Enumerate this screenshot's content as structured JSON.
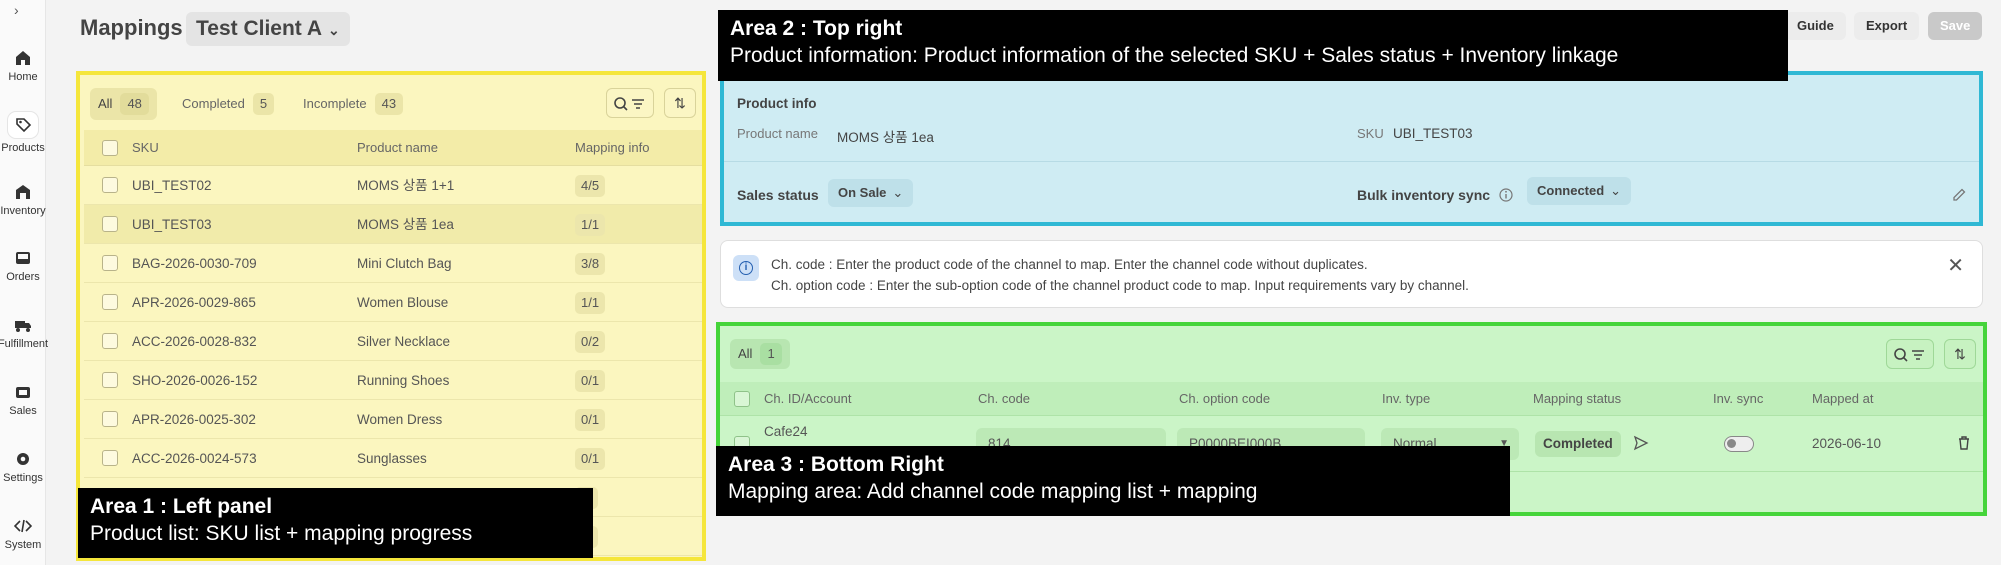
{
  "nav": {
    "toggle_icon": "chevron-right-icon",
    "items": [
      {
        "label": "Home",
        "icon": "home-icon"
      },
      {
        "label": "Products",
        "icon": "tag-icon",
        "active": true
      },
      {
        "label": "Inventory",
        "icon": "warehouse-icon"
      },
      {
        "label": "Orders",
        "icon": "inbox-icon"
      },
      {
        "label": "Fulfillment",
        "icon": "truck-icon"
      },
      {
        "label": "Sales",
        "icon": "store-icon"
      },
      {
        "label": "Settings",
        "icon": "gear-icon"
      },
      {
        "label": "System",
        "icon": "code-icon"
      }
    ]
  },
  "header": {
    "title": "Mappings",
    "client": "Test Client A",
    "guide_label": "Guide",
    "export_label": "Export",
    "save_label": "Save"
  },
  "left_panel": {
    "filters": [
      {
        "label": "All",
        "count": "48",
        "active": true
      },
      {
        "label": "Completed",
        "count": "5"
      },
      {
        "label": "Incomplete",
        "count": "43"
      }
    ],
    "columns": [
      "SKU",
      "Product name",
      "Mapping info"
    ],
    "rows": [
      {
        "sku": "UBI_TEST02",
        "name": "MOMS 상품 1+1",
        "mapping": "4/5"
      },
      {
        "sku": "UBI_TEST03",
        "name": "MOMS 상품 1ea",
        "mapping": "1/1",
        "selected": true
      },
      {
        "sku": "BAG-2026-0030-709",
        "name": "Mini Clutch Bag",
        "mapping": "3/8"
      },
      {
        "sku": "APR-2026-0029-865",
        "name": "Women Blouse",
        "mapping": "1/1"
      },
      {
        "sku": "ACC-2026-0028-832",
        "name": "Silver Necklace",
        "mapping": "0/2"
      },
      {
        "sku": "SHO-2026-0026-152",
        "name": "Running Shoes",
        "mapping": "0/1"
      },
      {
        "sku": "APR-2026-0025-302",
        "name": "Women Dress",
        "mapping": "0/1"
      },
      {
        "sku": "ACC-2026-0024-573",
        "name": "Sunglasses",
        "mapping": "0/1"
      },
      {
        "sku": "",
        "name": "",
        "mapping": "/3"
      },
      {
        "sku": "",
        "name": "",
        "mapping": "/1"
      }
    ]
  },
  "area1": {
    "title": "Area 1 : Left panel",
    "desc": "Product list: SKU list + mapping progress"
  },
  "area2": {
    "title": "Area 2 : Top right",
    "desc": "Product information: Product information of the selected SKU + Sales status + Inventory linkage"
  },
  "area3": {
    "title": "Area 3 : Bottom Right",
    "desc": "Mapping area: Add channel code mapping list + mapping"
  },
  "product_info": {
    "title": "Product info",
    "name_label": "Product name",
    "name_value": "MOMS 상품 1ea",
    "sku_label": "SKU",
    "sku_value": "UBI_TEST03",
    "sales_status_label": "Sales status",
    "sales_status_value": "On Sale",
    "bulk_sync_label": "Bulk inventory sync",
    "bulk_sync_value": "Connected"
  },
  "notice": {
    "line1": "Ch. code : Enter the product code of the channel to map. Enter the channel code without duplicates.",
    "line2": "Ch. option code : Enter the sub-option code of the channel product code to map. Input requirements vary by channel."
  },
  "mapping": {
    "filter_label": "All",
    "filter_count": "1",
    "columns": [
      "Ch. ID/Account",
      "Ch. code",
      "Ch. option code",
      "Inv. type",
      "Mapping status",
      "Inv. sync",
      "Mapped at"
    ],
    "row": {
      "channel": "Cafe24",
      "ch_code": "814",
      "option_code": "P0000BEI000B",
      "inv_type": "Normal",
      "status": "Completed",
      "inv_sync": false,
      "mapped_at": "2026-06-10"
    }
  },
  "colors": {
    "area1_border": "#f5e63b",
    "area2_border": "#2fb8d4",
    "area3_border": "#45d43a"
  }
}
